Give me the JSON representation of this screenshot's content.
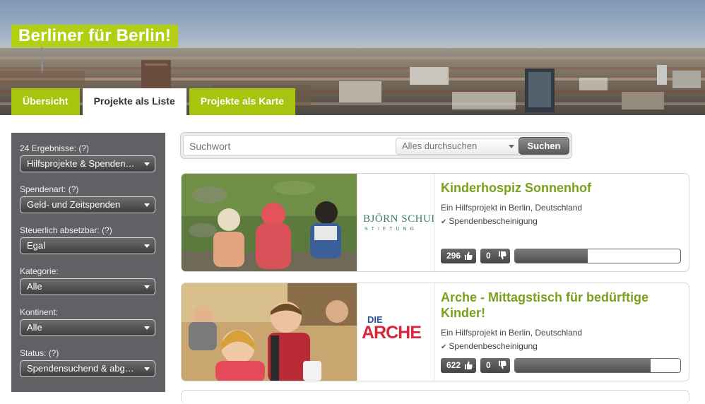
{
  "site": {
    "title": "Berliner für Berlin!"
  },
  "tabs": [
    {
      "label": "Übersicht",
      "active": false
    },
    {
      "label": "Projekte als Liste",
      "active": true
    },
    {
      "label": "Projekte als Karte",
      "active": false
    }
  ],
  "filters": [
    {
      "label": "24 Ergebnisse: (?)",
      "value": "Hilfsprojekte & Spenden…"
    },
    {
      "label": "Spendenart: (?)",
      "value": "Geld- und Zeitspenden"
    },
    {
      "label": "Steuerlich absetzbar: (?)",
      "value": "Egal"
    },
    {
      "label": "Kategorie:",
      "value": "Alle"
    },
    {
      "label": "Kontinent:",
      "value": "Alle"
    },
    {
      "label": "Status: (?)",
      "value": "Spendensuchend & abg…"
    }
  ],
  "search": {
    "placeholder": "Suchwort",
    "scope": "Alles durchsuchen",
    "button": "Suchen"
  },
  "projects": [
    {
      "title": "Kinderhospiz Sonnenhof",
      "location": "Ein Hilfsprojekt in Berlin, Deutschland",
      "certificate": "Spendenbescheinigung",
      "likes": "296",
      "dislikes": "0",
      "progress": 0.44,
      "logo_text_1": "BJÖRN SCHULZ",
      "logo_text_2": "STIFTUNG"
    },
    {
      "title": "Arche - Mittagstisch für bedürftige Kinder!",
      "location": "Ein Hilfsprojekt in Berlin, Deutschland",
      "certificate": "Spendenbescheinigung",
      "likes": "622",
      "dislikes": "0",
      "progress": 0.82,
      "logo_text_1": "DIE",
      "logo_text_2": "ARCHE"
    }
  ],
  "colors": {
    "accent": "#a7c40f",
    "title_green": "#7ba01b",
    "sidebar": "#5f6164"
  },
  "icons": [
    "thumbs-up-icon",
    "thumbs-down-icon",
    "chevron-down-icon",
    "check-icon"
  ]
}
